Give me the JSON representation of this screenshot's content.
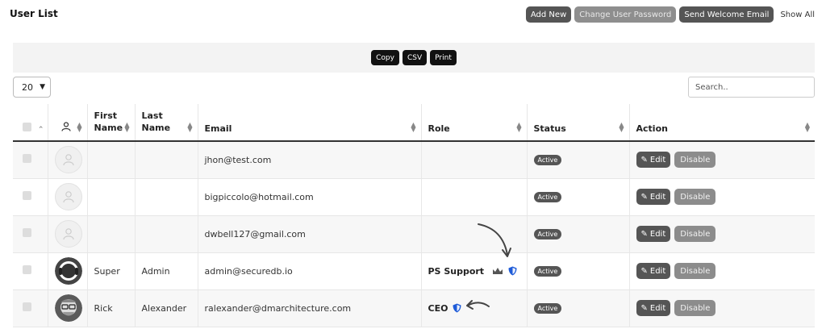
{
  "header": {
    "title": "User List"
  },
  "top_actions": {
    "add_new": "Add New",
    "change_password": "Change User Password",
    "send_welcome": "Send Welcome Email",
    "show_all": "Show All"
  },
  "export": {
    "copy": "Copy",
    "csv": "CSV",
    "print": "Print"
  },
  "controls": {
    "page_size": "20",
    "search_placeholder": "Search.."
  },
  "table": {
    "columns": {
      "first_name": "First Name",
      "last_name": "Last Name",
      "email": "Email",
      "role": "Role",
      "status": "Status",
      "action": "Action"
    },
    "rows": [
      {
        "first": "",
        "last": "",
        "email": "jhon@test.com",
        "role": "",
        "status": "Active",
        "edit": "Edit",
        "disable": "Disable"
      },
      {
        "first": "",
        "last": "",
        "email": "bigpiccolo@hotmail.com",
        "role": "",
        "status": "Active",
        "edit": "Edit",
        "disable": "Disable"
      },
      {
        "first": "",
        "last": "",
        "email": "dwbell127@gmail.com",
        "role": "",
        "status": "Active",
        "edit": "Edit",
        "disable": "Disable"
      },
      {
        "first": "Super",
        "last": "Admin",
        "email": "admin@securedb.io",
        "role": "PS Support",
        "status": "Active",
        "edit": "Edit",
        "disable": "Disable"
      },
      {
        "first": "Rick",
        "last": "Alexander",
        "email": "ralexander@dmarchitecture.com",
        "role": "CEO",
        "status": "Active",
        "edit": "Edit",
        "disable": "Disable"
      }
    ]
  },
  "icons": {
    "user": "user-icon",
    "crown": "crown-icon",
    "shield": "shield-icon",
    "pencil": "pencil-icon"
  }
}
